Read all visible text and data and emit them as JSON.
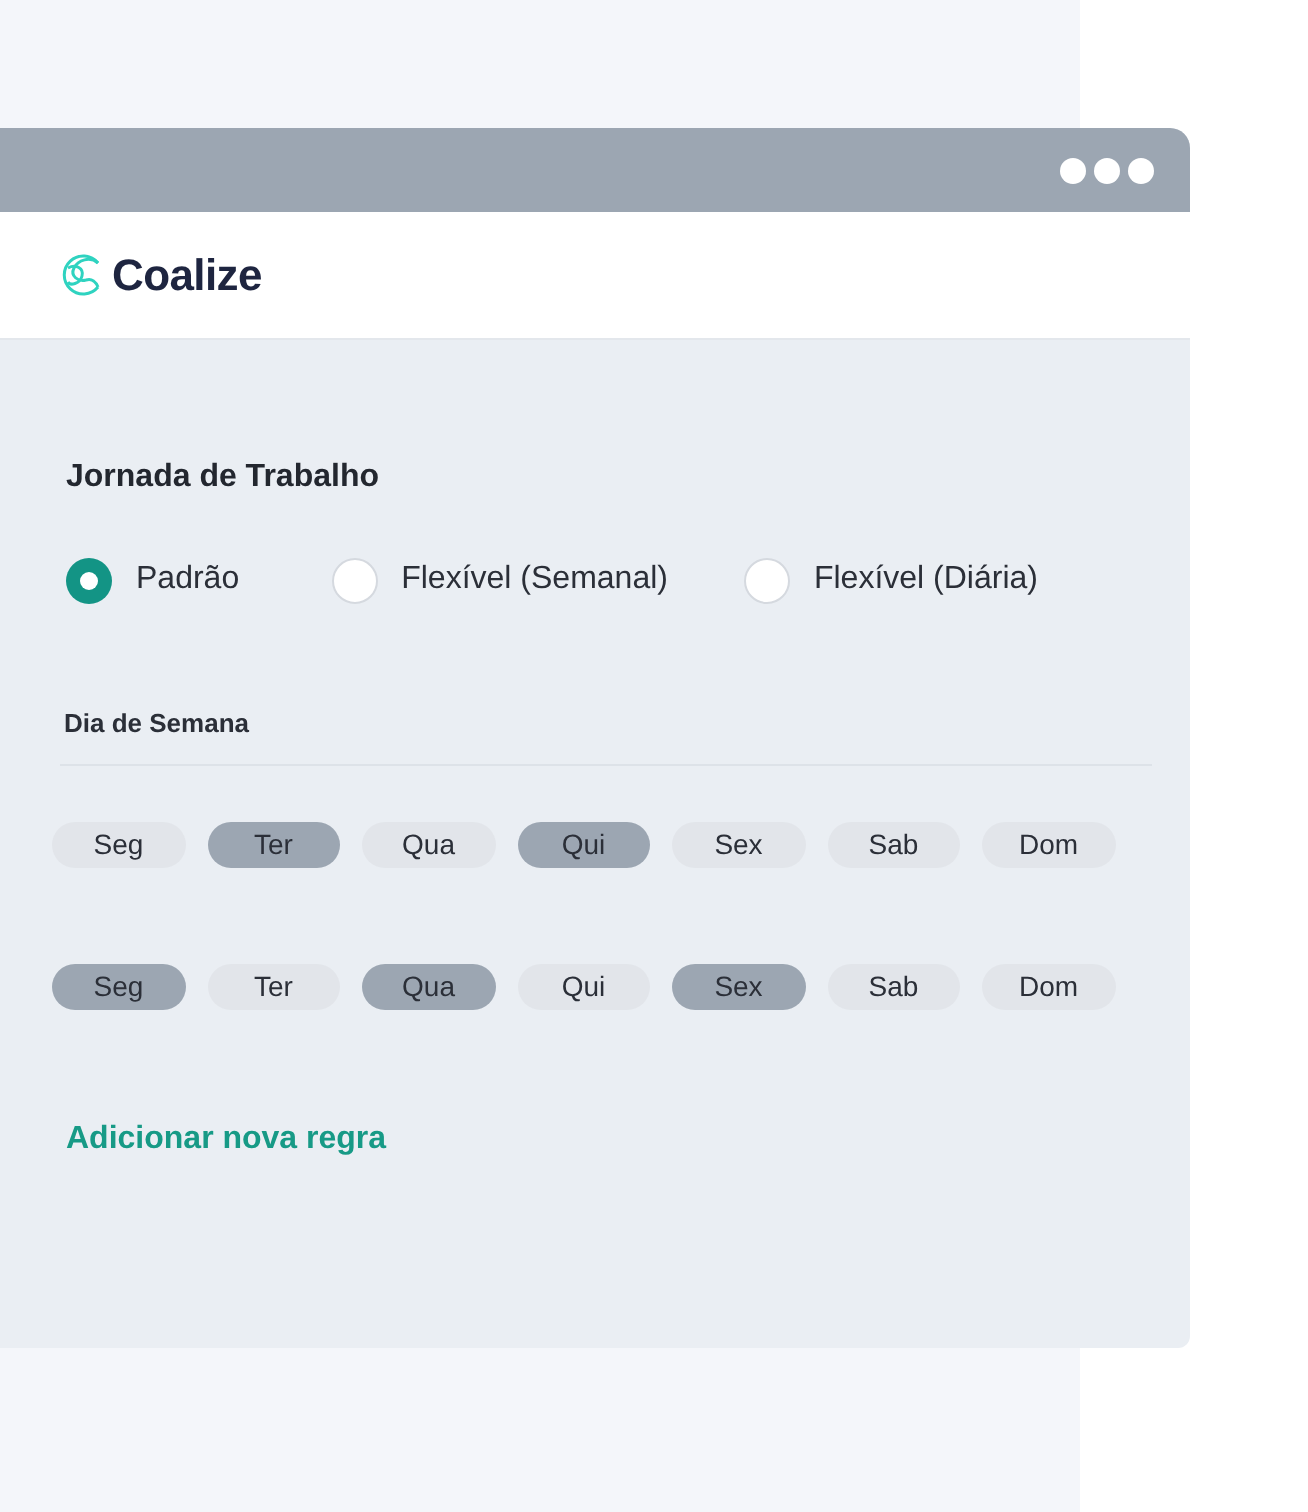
{
  "header": {
    "brand": "Coalize"
  },
  "work_schedule": {
    "title": "Jornada de Trabalho",
    "options": [
      {
        "label": "Padrão",
        "selected": true
      },
      {
        "label": "Flexível (Semanal)",
        "selected": false
      },
      {
        "label": "Flexível (Diária)",
        "selected": false
      }
    ]
  },
  "weekdays": {
    "label": "Dia de Semana",
    "rules": [
      {
        "days": [
          {
            "label": "Seg",
            "selected": false
          },
          {
            "label": "Ter",
            "selected": true
          },
          {
            "label": "Qua",
            "selected": false
          },
          {
            "label": "Qui",
            "selected": true
          },
          {
            "label": "Sex",
            "selected": false
          },
          {
            "label": "Sab",
            "selected": false
          },
          {
            "label": "Dom",
            "selected": false
          }
        ]
      },
      {
        "days": [
          {
            "label": "Seg",
            "selected": true
          },
          {
            "label": "Ter",
            "selected": false
          },
          {
            "label": "Qua",
            "selected": true
          },
          {
            "label": "Qui",
            "selected": false
          },
          {
            "label": "Sex",
            "selected": true
          },
          {
            "label": "Sab",
            "selected": false
          },
          {
            "label": "Dom",
            "selected": false
          }
        ]
      }
    ]
  },
  "add_rule_link": "Adicionar nova regra"
}
